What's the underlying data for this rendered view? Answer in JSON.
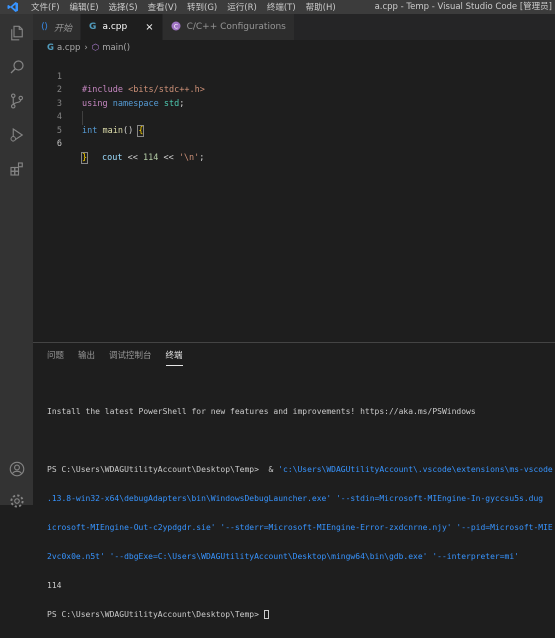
{
  "titlebar": {
    "menu": [
      "文件(F)",
      "编辑(E)",
      "选择(S)",
      "查看(V)",
      "转到(G)",
      "运行(R)",
      "终端(T)",
      "帮助(H)"
    ],
    "window_title": "a.cpp - Temp - Visual Studio Code [管理员]"
  },
  "activity_icons": [
    "explorer-icon",
    "search-icon",
    "source-control-icon",
    "run-debug-icon",
    "extensions-icon",
    "account-icon",
    "settings-gear-icon"
  ],
  "tabs": [
    {
      "label": "开始",
      "icon": "vscode-logo-icon"
    },
    {
      "label": "a.cpp",
      "icon": "cpp-file-icon",
      "close": "×"
    },
    {
      "label": "C/C++ Configurations",
      "icon": "c-cpp-extension-icon"
    }
  ],
  "breadcrumb": {
    "file": "a.cpp",
    "symbol": "main()"
  },
  "editor": {
    "line_numbers": [
      "1",
      "2",
      "3",
      "4",
      "5",
      "6"
    ],
    "l1": {
      "directive": "#include",
      "header": "<bits/stdc++.h>"
    },
    "l2": {
      "kw1": "using",
      "kw2": "namespace",
      "ns": "std",
      "semi": ";"
    },
    "l4": {
      "type": "int",
      "fn": "main",
      "paren": "() ",
      "brace": "{"
    },
    "l5": {
      "var": "cout",
      "op1": " << ",
      "num": "114",
      "op2": " << ",
      "str": "'\\n'",
      "semi": ";"
    },
    "l6": {
      "brace": "}"
    }
  },
  "panel": {
    "tabs": [
      "问题",
      "输出",
      "调试控制台",
      "终端"
    ],
    "terminal": {
      "line1": "Install the latest PowerShell for new features and improvements! https://aka.ms/PSWindows",
      "prompt": "PS C:\\Users\\WDAGUtilityAccount\\Desktop\\Temp>",
      "amp": "  & ",
      "cmd1": "'c:\\Users\\WDAGUtilityAccount\\.vscode\\extensions\\ms-vscode",
      "cmd2": ".13.8-win32-x64\\debugAdapters\\bin\\WindowsDebugLauncher.exe' '--stdin=Microsoft-MIEngine-In-gyccsu5s.dug",
      "cmd3": "icrosoft-MIEngine-Out-c2ypdgdr.sie' '--stderr=Microsoft-MIEngine-Error-zxdcnrne.njy' '--pid=Microsoft-MIE",
      "cmd4": "2vc0x0e.n5t' '--dbgExe=C:\\Users\\WDAGUtilityAccount\\Desktop\\mingw64\\bin\\gdb.exe' '--interpreter=mi'",
      "output": "114",
      "prompt2": "PS C:\\Users\\WDAGUtilityAccount\\Desktop\\Temp>"
    }
  },
  "colors": {
    "accent": "#007acc",
    "keyword": "#c586c0",
    "type": "#569cd6",
    "string": "#ce9178"
  }
}
